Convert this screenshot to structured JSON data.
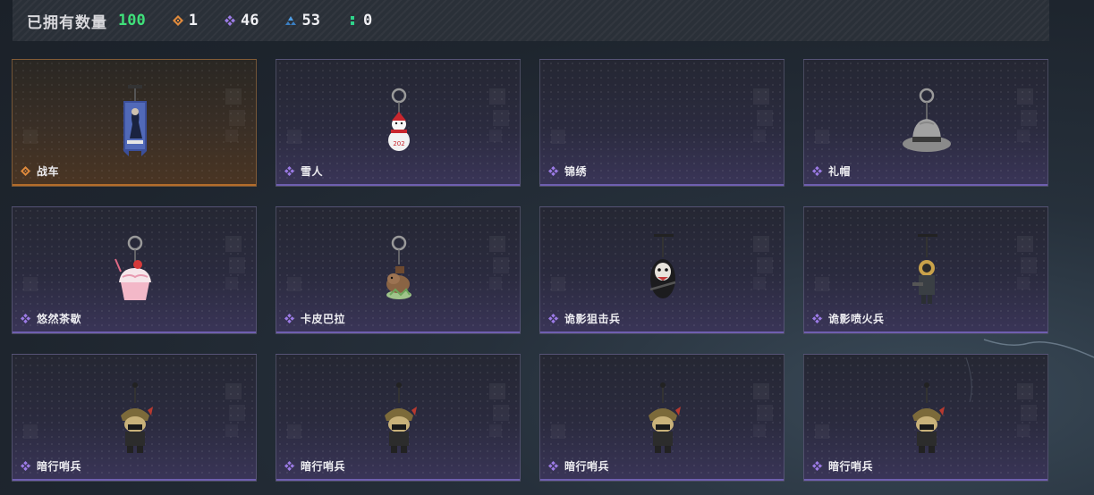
{
  "header": {
    "owned_label": "已拥有数量",
    "owned_count": "100",
    "stats": [
      {
        "rarity": "gold",
        "icon": "orange-diamond-icon",
        "value": "1",
        "color": "#e08a3c"
      },
      {
        "rarity": "purple",
        "icon": "purple-clover-icon",
        "value": "46",
        "color": "#9c7be6"
      },
      {
        "rarity": "blue",
        "icon": "blue-triangle-icon",
        "value": "53",
        "color": "#4f9ee6"
      },
      {
        "rarity": "green",
        "icon": "green-dots-icon",
        "value": "0",
        "color": "#2fd38a"
      }
    ]
  },
  "items": [
    {
      "name": "战车",
      "rarity": "gold",
      "art": "banner-charm-icon"
    },
    {
      "name": "雪人",
      "rarity": "purple",
      "art": "snowman-charm-icon"
    },
    {
      "name": "锦绣",
      "rarity": "purple",
      "art": "empty"
    },
    {
      "name": "礼帽",
      "rarity": "purple",
      "art": "fedora-hat-charm-icon"
    },
    {
      "name": "悠然茶歇",
      "rarity": "purple",
      "art": "cupcake-charm-icon"
    },
    {
      "name": "卡皮巴拉",
      "rarity": "purple",
      "art": "capybara-charm-icon"
    },
    {
      "name": "诡影狙击兵",
      "rarity": "purple",
      "art": "sniper-charm-icon"
    },
    {
      "name": "诡影喷火兵",
      "rarity": "purple",
      "art": "flamethrower-charm-icon"
    },
    {
      "name": "暗行哨兵",
      "rarity": "purple",
      "art": "sentry-charm-icon"
    },
    {
      "name": "暗行哨兵",
      "rarity": "purple",
      "art": "sentry-charm-icon"
    },
    {
      "name": "暗行哨兵",
      "rarity": "purple",
      "art": "sentry-charm-icon"
    },
    {
      "name": "暗行哨兵",
      "rarity": "purple",
      "art": "sentry-charm-icon"
    }
  ]
}
